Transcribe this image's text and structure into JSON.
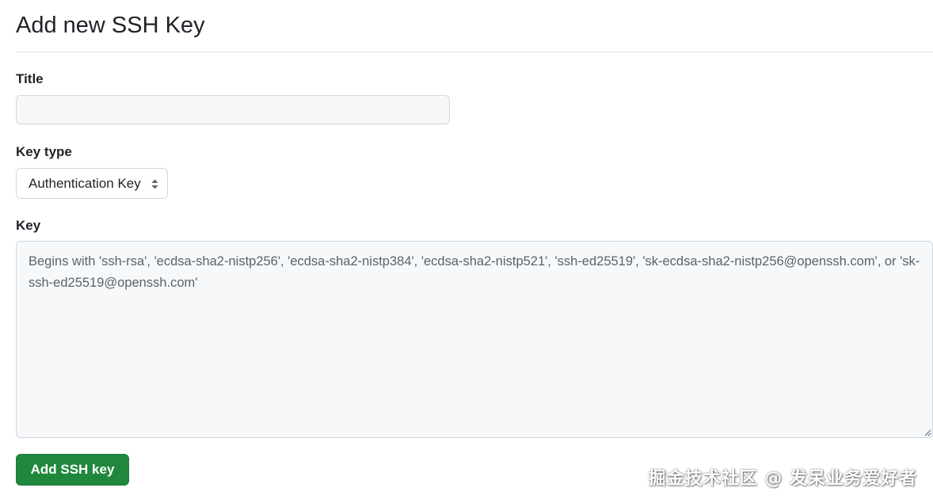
{
  "page": {
    "heading": "Add new SSH Key"
  },
  "form": {
    "title": {
      "label": "Title",
      "value": "",
      "placeholder": ""
    },
    "key_type": {
      "label": "Key type",
      "selected": "Authentication Key",
      "icon": "select-arrows-icon"
    },
    "key": {
      "label": "Key",
      "value": "",
      "placeholder": "Begins with 'ssh-rsa', 'ecdsa-sha2-nistp256', 'ecdsa-sha2-nistp384', 'ecdsa-sha2-nistp521', 'ssh-ed25519', 'sk-ecdsa-sha2-nistp256@openssh.com', or 'sk-ssh-ed25519@openssh.com'"
    },
    "submit_label": "Add SSH key"
  },
  "watermark": {
    "text": "掘金技术社区 @ 发呆业务爱好者"
  },
  "colors": {
    "primary_button": "#1f883d",
    "input_background": "#f6f8fa",
    "border": "#d0d7de"
  }
}
